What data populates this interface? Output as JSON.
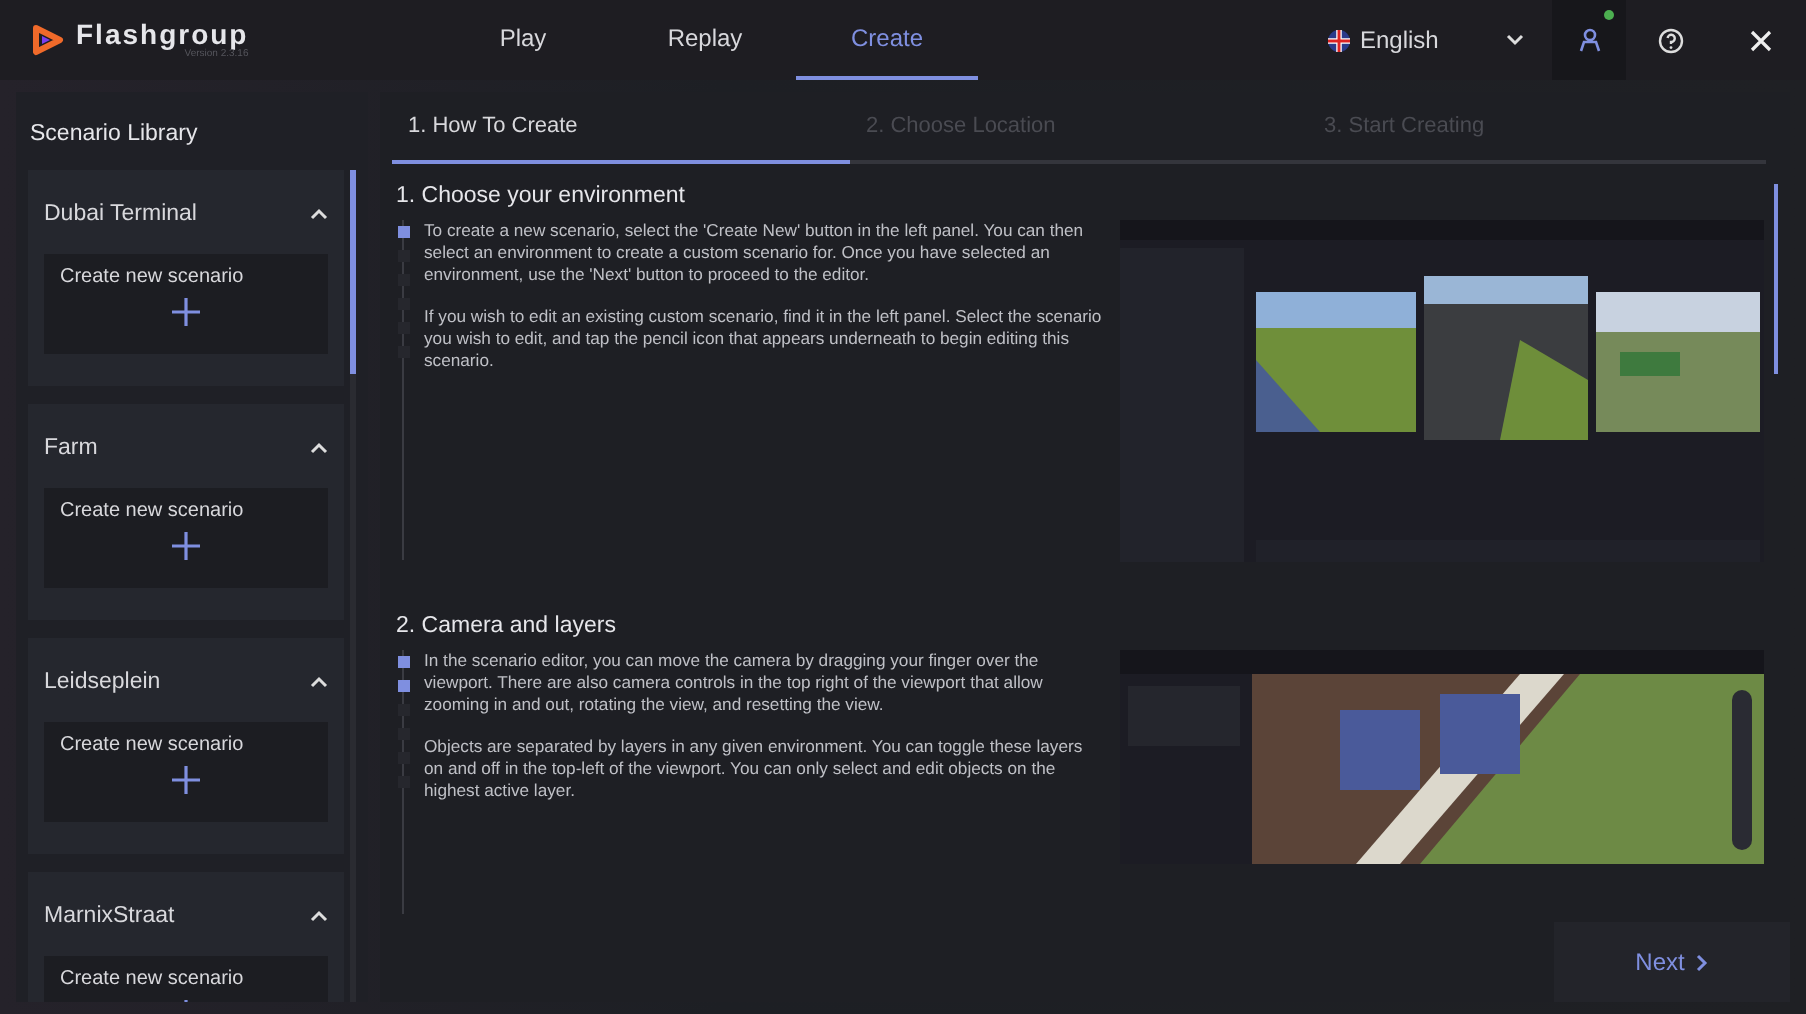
{
  "brand": {
    "name": "Flashgroup",
    "version": "Version 2.3.16"
  },
  "nav": [
    {
      "label": "Play",
      "selected": false
    },
    {
      "label": "Replay",
      "selected": false
    },
    {
      "label": "Create",
      "selected": true
    }
  ],
  "language": {
    "value": "English"
  },
  "user": {
    "online": true
  },
  "sidebar": {
    "title": "Scenario Library",
    "environments": [
      {
        "name": "Dubai Terminal",
        "expanded": true,
        "create_label": "Create new scenario"
      },
      {
        "name": "Farm",
        "expanded": true,
        "create_label": "Create new scenario"
      },
      {
        "name": "Leidseplein",
        "expanded": true,
        "create_label": "Create new scenario"
      },
      {
        "name": "MarnixStraat",
        "expanded": true,
        "create_label": "Create new scenario"
      }
    ]
  },
  "steps": [
    {
      "label": "1. How To Create",
      "selected": true
    },
    {
      "label": "2. Choose Location",
      "selected": false
    },
    {
      "label": "3. Start Creating",
      "selected": false
    }
  ],
  "sections": [
    {
      "heading": "1. Choose your environment",
      "paragraphs": [
        "To create a new scenario, select the 'Create New' button in the left panel. You can then select an environment to create a custom scenario for. Once you have selected an environment, use the 'Next' button to proceed to the editor.",
        "If you wish to edit an existing custom scenario, find it in the left panel. Select the scenario you wish to edit, and tap the pencil icon that appears underneath to begin editing this scenario."
      ],
      "markers": [
        {
          "lit": true
        },
        {
          "lit": false
        },
        {
          "lit": false
        },
        {
          "lit": false
        },
        {
          "lit": false
        },
        {
          "lit": false
        }
      ],
      "image": {
        "kind": "picture"
      }
    },
    {
      "heading": "2. Camera and layers",
      "paragraphs": [
        "In the scenario editor, you can move the camera by dragging your finger over the viewport. There are also camera controls in the top right of the viewport that allow zooming in and out, rotating the view, and resetting the view.",
        "Objects are separated by layers in any given environment. You can toggle these layers on and off in the top-left of the viewport. You can only select and edit objects on the highest active layer."
      ],
      "markers": [
        {
          "lit": true
        },
        {
          "lit": true
        },
        {
          "lit": false
        },
        {
          "lit": false
        },
        {
          "lit": false
        },
        {
          "lit": false
        }
      ],
      "image": {
        "kind": "picture"
      }
    }
  ],
  "footer": {
    "next_label": "Next"
  }
}
